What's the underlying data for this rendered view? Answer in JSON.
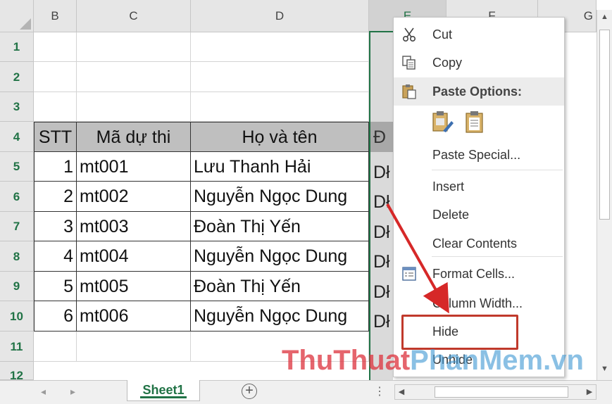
{
  "columns": [
    "B",
    "C",
    "D",
    "E",
    "F",
    "G"
  ],
  "rows": [
    "1",
    "2",
    "3",
    "4",
    "5",
    "6",
    "7",
    "8",
    "9",
    "10",
    "11",
    "12"
  ],
  "table": {
    "headers": [
      "STT",
      "Mã dự thi",
      "Họ và tên",
      "Đ"
    ],
    "records": [
      {
        "stt": "1",
        "code": "mt001",
        "name": "Lưu Thanh Hải",
        "e": "Dł"
      },
      {
        "stt": "2",
        "code": "mt002",
        "name": "Nguyễn Ngọc Dung",
        "e": "Dł"
      },
      {
        "stt": "3",
        "code": "mt003",
        "name": "Đoàn Thị Yến",
        "e": "Dł"
      },
      {
        "stt": "4",
        "code": "mt004",
        "name": "Nguyễn Ngọc Dung",
        "e": "Dł"
      },
      {
        "stt": "5",
        "code": "mt005",
        "name": "Đoàn Thị Yến",
        "e": "Dł"
      },
      {
        "stt": "6",
        "code": "mt006",
        "name": "Nguyễn Ngọc Dung",
        "e": "Dł"
      }
    ]
  },
  "context_menu": {
    "cut": "Cut",
    "copy": "Copy",
    "paste_options": "Paste Options:",
    "paste_special": "Paste Special...",
    "insert": "Insert",
    "delete": "Delete",
    "clear_contents": "Clear Contents",
    "format_cells": "Format Cells...",
    "column_width": "Column Width...",
    "hide": "Hide",
    "unhide": "Unhide"
  },
  "sheet_tab": "Sheet1",
  "add_sheet_symbol": "+",
  "tab_more_symbol": "⋮",
  "watermark": {
    "part1": "ThuThuat",
    "part2": "PhanMem.vn"
  },
  "icons": {
    "cut": "scissors-icon",
    "copy": "copy-icon",
    "paste": "paste-icon",
    "format": "format-cells-icon",
    "add": "plus-circle-icon"
  },
  "colors": {
    "excel_green": "#217346",
    "highlight_red": "#c0392b",
    "header_fill": "#bfbfbf"
  }
}
